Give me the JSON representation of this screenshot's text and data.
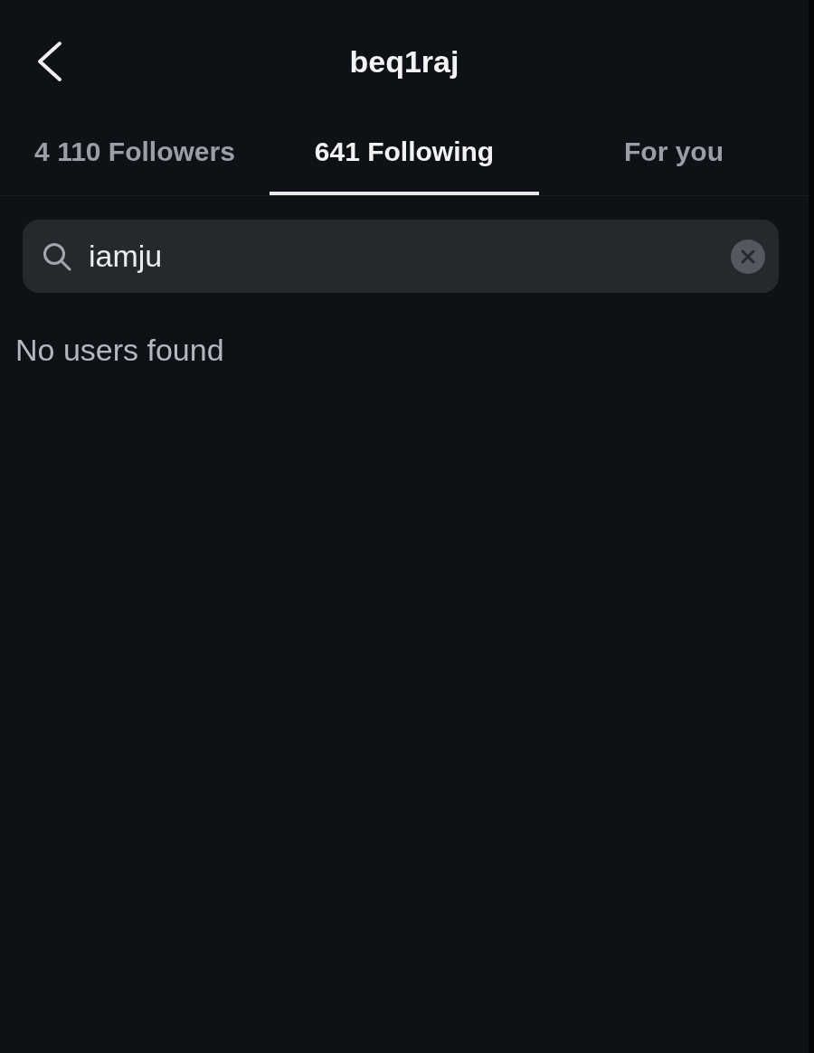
{
  "header": {
    "title": "beq1raj"
  },
  "tabs": [
    {
      "label": "4 110 Followers",
      "selected": false
    },
    {
      "label": "641 Following",
      "selected": true
    },
    {
      "label": "For you",
      "selected": false
    }
  ],
  "search": {
    "value": "iamju"
  },
  "empty_message": "No users found"
}
